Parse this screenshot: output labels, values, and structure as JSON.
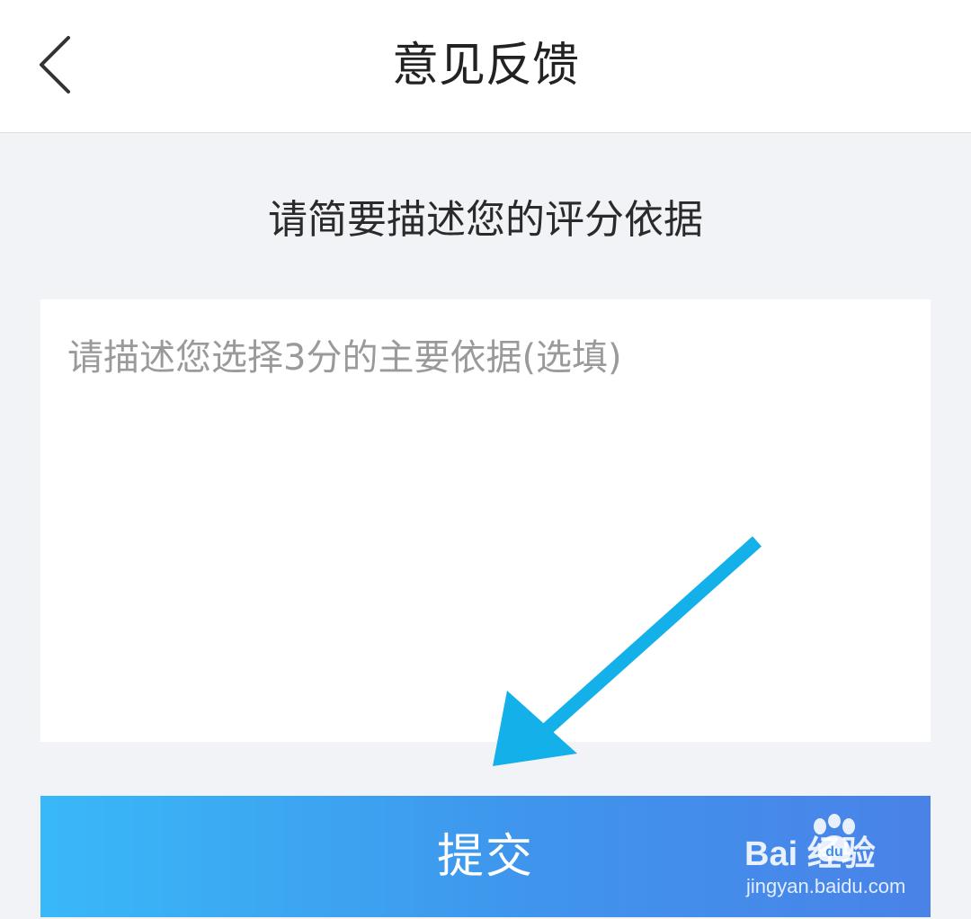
{
  "header": {
    "title": "意见反馈",
    "back_icon": "chevron-left-icon"
  },
  "main": {
    "section_title": "请简要描述您的评分依据",
    "feedback_input": {
      "value": "",
      "placeholder": "请描述您选择3分的主要依据(选填)"
    },
    "submit_label": "提交"
  },
  "annotation": {
    "arrow_icon": "arrow-down-left-icon",
    "arrow_color": "#13b0ea"
  },
  "watermark": {
    "brand": "Bai  经验",
    "url": "jingyan.baidu.com"
  },
  "colors": {
    "background": "#f2f3f7",
    "button_gradient_start": "#39b8f8",
    "button_gradient_end": "#4a82e8"
  }
}
